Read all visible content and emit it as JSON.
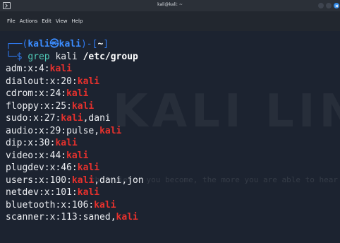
{
  "window": {
    "title": "kali@kali: ~"
  },
  "menubar": {
    "items": [
      "File",
      "Actions",
      "Edit",
      "View",
      "Help"
    ]
  },
  "terminal": {
    "prompt": {
      "line1_prefix": "┌──(",
      "user": "kali",
      "at_symbol": "㉿",
      "host": "kali",
      "bracket_close": ")-[",
      "dir": "~",
      "dir_close": "]",
      "line2_prefix": "└─$ ",
      "command": "grep",
      "arg": "kali",
      "path": "/etc/group"
    },
    "watermark": {
      "text": "KALI LINUX",
      "quote": "the quieter you become, the more you are able to hear"
    },
    "output": [
      {
        "pre": "adm:x:4:",
        "hl": "kali",
        "post": ""
      },
      {
        "pre": "dialout:x:20:",
        "hl": "kali",
        "post": ""
      },
      {
        "pre": "cdrom:x:24:",
        "hl": "kali",
        "post": ""
      },
      {
        "pre": "floppy:x:25:",
        "hl": "kali",
        "post": ""
      },
      {
        "pre": "sudo:x:27:",
        "hl": "kali",
        "post": ",dani"
      },
      {
        "pre": "audio:x:29:pulse,",
        "hl": "kali",
        "post": ""
      },
      {
        "pre": "dip:x:30:",
        "hl": "kali",
        "post": ""
      },
      {
        "pre": "video:x:44:",
        "hl": "kali",
        "post": ""
      },
      {
        "pre": "plugdev:x:46:",
        "hl": "kali",
        "post": ""
      },
      {
        "pre": "users:x:100:",
        "hl": "kali",
        "post": ",dani,jon"
      },
      {
        "pre": "netdev:x:101:",
        "hl": "kali",
        "post": ""
      },
      {
        "pre": "bluetooth:x:106:",
        "hl": "kali",
        "post": ""
      },
      {
        "pre": "scanner:x:113:saned,",
        "hl": "kali",
        "post": ""
      }
    ]
  },
  "colors": {
    "background": "#1c2330",
    "prompt": "#2f7cf6",
    "command": "#4ec7b6",
    "highlight": "#e6312d",
    "close_button": "#2e88e8"
  }
}
